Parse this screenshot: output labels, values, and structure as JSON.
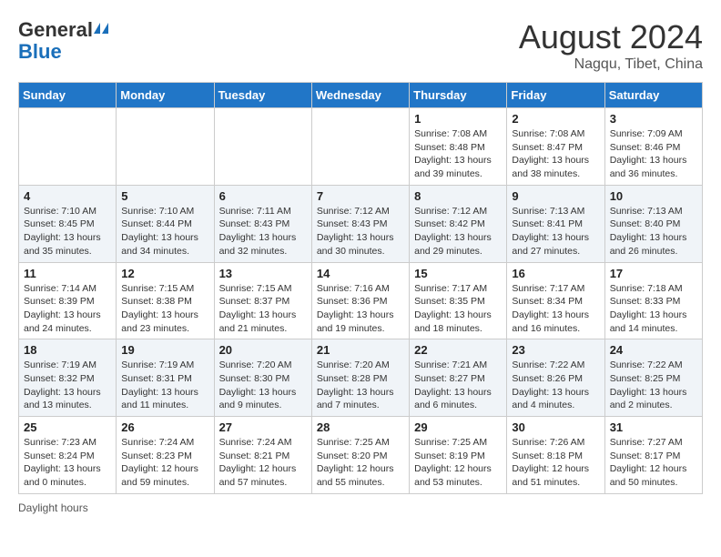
{
  "header": {
    "logo_general": "General",
    "logo_blue": "Blue",
    "month_year": "August 2024",
    "location": "Nagqu, Tibet, China"
  },
  "calendar": {
    "days_of_week": [
      "Sunday",
      "Monday",
      "Tuesday",
      "Wednesday",
      "Thursday",
      "Friday",
      "Saturday"
    ],
    "weeks": [
      [
        {
          "day": "",
          "info": ""
        },
        {
          "day": "",
          "info": ""
        },
        {
          "day": "",
          "info": ""
        },
        {
          "day": "",
          "info": ""
        },
        {
          "day": "1",
          "info": "Sunrise: 7:08 AM\nSunset: 8:48 PM\nDaylight: 13 hours\nand 39 minutes."
        },
        {
          "day": "2",
          "info": "Sunrise: 7:08 AM\nSunset: 8:47 PM\nDaylight: 13 hours\nand 38 minutes."
        },
        {
          "day": "3",
          "info": "Sunrise: 7:09 AM\nSunset: 8:46 PM\nDaylight: 13 hours\nand 36 minutes."
        }
      ],
      [
        {
          "day": "4",
          "info": "Sunrise: 7:10 AM\nSunset: 8:45 PM\nDaylight: 13 hours\nand 35 minutes."
        },
        {
          "day": "5",
          "info": "Sunrise: 7:10 AM\nSunset: 8:44 PM\nDaylight: 13 hours\nand 34 minutes."
        },
        {
          "day": "6",
          "info": "Sunrise: 7:11 AM\nSunset: 8:43 PM\nDaylight: 13 hours\nand 32 minutes."
        },
        {
          "day": "7",
          "info": "Sunrise: 7:12 AM\nSunset: 8:43 PM\nDaylight: 13 hours\nand 30 minutes."
        },
        {
          "day": "8",
          "info": "Sunrise: 7:12 AM\nSunset: 8:42 PM\nDaylight: 13 hours\nand 29 minutes."
        },
        {
          "day": "9",
          "info": "Sunrise: 7:13 AM\nSunset: 8:41 PM\nDaylight: 13 hours\nand 27 minutes."
        },
        {
          "day": "10",
          "info": "Sunrise: 7:13 AM\nSunset: 8:40 PM\nDaylight: 13 hours\nand 26 minutes."
        }
      ],
      [
        {
          "day": "11",
          "info": "Sunrise: 7:14 AM\nSunset: 8:39 PM\nDaylight: 13 hours\nand 24 minutes."
        },
        {
          "day": "12",
          "info": "Sunrise: 7:15 AM\nSunset: 8:38 PM\nDaylight: 13 hours\nand 23 minutes."
        },
        {
          "day": "13",
          "info": "Sunrise: 7:15 AM\nSunset: 8:37 PM\nDaylight: 13 hours\nand 21 minutes."
        },
        {
          "day": "14",
          "info": "Sunrise: 7:16 AM\nSunset: 8:36 PM\nDaylight: 13 hours\nand 19 minutes."
        },
        {
          "day": "15",
          "info": "Sunrise: 7:17 AM\nSunset: 8:35 PM\nDaylight: 13 hours\nand 18 minutes."
        },
        {
          "day": "16",
          "info": "Sunrise: 7:17 AM\nSunset: 8:34 PM\nDaylight: 13 hours\nand 16 minutes."
        },
        {
          "day": "17",
          "info": "Sunrise: 7:18 AM\nSunset: 8:33 PM\nDaylight: 13 hours\nand 14 minutes."
        }
      ],
      [
        {
          "day": "18",
          "info": "Sunrise: 7:19 AM\nSunset: 8:32 PM\nDaylight: 13 hours\nand 13 minutes."
        },
        {
          "day": "19",
          "info": "Sunrise: 7:19 AM\nSunset: 8:31 PM\nDaylight: 13 hours\nand 11 minutes."
        },
        {
          "day": "20",
          "info": "Sunrise: 7:20 AM\nSunset: 8:30 PM\nDaylight: 13 hours\nand 9 minutes."
        },
        {
          "day": "21",
          "info": "Sunrise: 7:20 AM\nSunset: 8:28 PM\nDaylight: 13 hours\nand 7 minutes."
        },
        {
          "day": "22",
          "info": "Sunrise: 7:21 AM\nSunset: 8:27 PM\nDaylight: 13 hours\nand 6 minutes."
        },
        {
          "day": "23",
          "info": "Sunrise: 7:22 AM\nSunset: 8:26 PM\nDaylight: 13 hours\nand 4 minutes."
        },
        {
          "day": "24",
          "info": "Sunrise: 7:22 AM\nSunset: 8:25 PM\nDaylight: 13 hours\nand 2 minutes."
        }
      ],
      [
        {
          "day": "25",
          "info": "Sunrise: 7:23 AM\nSunset: 8:24 PM\nDaylight: 13 hours\nand 0 minutes."
        },
        {
          "day": "26",
          "info": "Sunrise: 7:24 AM\nSunset: 8:23 PM\nDaylight: 12 hours\nand 59 minutes."
        },
        {
          "day": "27",
          "info": "Sunrise: 7:24 AM\nSunset: 8:21 PM\nDaylight: 12 hours\nand 57 minutes."
        },
        {
          "day": "28",
          "info": "Sunrise: 7:25 AM\nSunset: 8:20 PM\nDaylight: 12 hours\nand 55 minutes."
        },
        {
          "day": "29",
          "info": "Sunrise: 7:25 AM\nSunset: 8:19 PM\nDaylight: 12 hours\nand 53 minutes."
        },
        {
          "day": "30",
          "info": "Sunrise: 7:26 AM\nSunset: 8:18 PM\nDaylight: 12 hours\nand 51 minutes."
        },
        {
          "day": "31",
          "info": "Sunrise: 7:27 AM\nSunset: 8:17 PM\nDaylight: 12 hours\nand 50 minutes."
        }
      ]
    ]
  },
  "footer": {
    "note": "Daylight hours"
  }
}
